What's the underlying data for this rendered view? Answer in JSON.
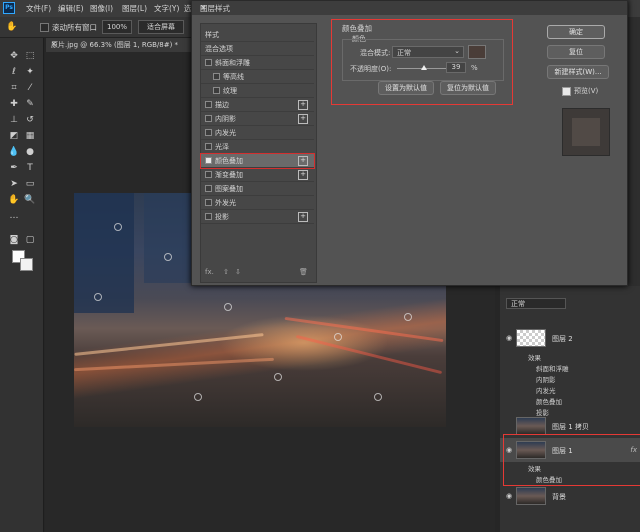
{
  "menubar": {
    "logo": "Ps",
    "items": [
      "文件(F)",
      "编辑(E)",
      "图像(I)",
      "图层(L)",
      "文字(Y)",
      "选择("
    ]
  },
  "options": {
    "scroll_all_windows": "滚动所有窗口",
    "zoom": "100%",
    "fit_screen": "适合屏幕"
  },
  "document_tab": {
    "title": "原片.jpg @ 66.3% (图层 1, RGB/8#) *",
    "close": "×"
  },
  "dialog": {
    "title": "图层样式",
    "close": "×",
    "style_list": [
      {
        "label": "样式",
        "type": "header",
        "checked": false,
        "plus": false
      },
      {
        "label": "混合选项",
        "type": "header",
        "checked": false,
        "plus": false
      },
      {
        "label": "斜面和浮雕",
        "type": "item",
        "checked": false,
        "plus": false
      },
      {
        "label": "等高线",
        "type": "sub",
        "checked": false,
        "plus": false
      },
      {
        "label": "纹理",
        "type": "sub",
        "checked": false,
        "plus": false
      },
      {
        "label": "描边",
        "type": "item",
        "checked": false,
        "plus": true
      },
      {
        "label": "内阴影",
        "type": "item",
        "checked": false,
        "plus": true
      },
      {
        "label": "内发光",
        "type": "item",
        "checked": false,
        "plus": false
      },
      {
        "label": "光泽",
        "type": "item",
        "checked": false,
        "plus": false
      },
      {
        "label": "颜色叠加",
        "type": "item",
        "checked": true,
        "plus": true,
        "selected": true
      },
      {
        "label": "渐变叠加",
        "type": "item",
        "checked": false,
        "plus": true
      },
      {
        "label": "图案叠加",
        "type": "item",
        "checked": false,
        "plus": false
      },
      {
        "label": "外发光",
        "type": "item",
        "checked": false,
        "plus": false
      },
      {
        "label": "投影",
        "type": "item",
        "checked": false,
        "plus": true
      }
    ],
    "list_footer": {
      "fx": "fx.",
      "up": "⇧",
      "down": "⇩",
      "trash": "🗑"
    },
    "panel": {
      "section_title": "颜色叠加",
      "group_title": "颜色",
      "blend_mode_label": "混合模式:",
      "blend_mode_value": "正常",
      "opacity_label": "不透明度(O):",
      "opacity_value": "39",
      "opacity_unit": "%",
      "opacity_level": 0.39,
      "overlay_color": "#4a3d38",
      "set_default": "设置为默认值",
      "reset_default": "复位为默认值"
    },
    "buttons": {
      "ok": "确定",
      "reset": "复位",
      "new_style": "新建样式(W)...",
      "preview_label": "预览(V)"
    }
  },
  "layers": {
    "blend_mode": "正常",
    "rows": [
      {
        "name": "图层 2",
        "effects": [
          "效果",
          "斜面和浮雕",
          "内阴影",
          "内发光",
          "颜色叠加",
          "投影"
        ]
      },
      {
        "name": "图层 1 拷贝",
        "effects": []
      },
      {
        "name": "图层 1",
        "effects": [
          "效果",
          "颜色叠加"
        ]
      },
      {
        "name": "背景",
        "effects": []
      }
    ],
    "fx": "fx"
  },
  "colors": {
    "highlight": "#e53935",
    "accent": "#31a8ff"
  }
}
